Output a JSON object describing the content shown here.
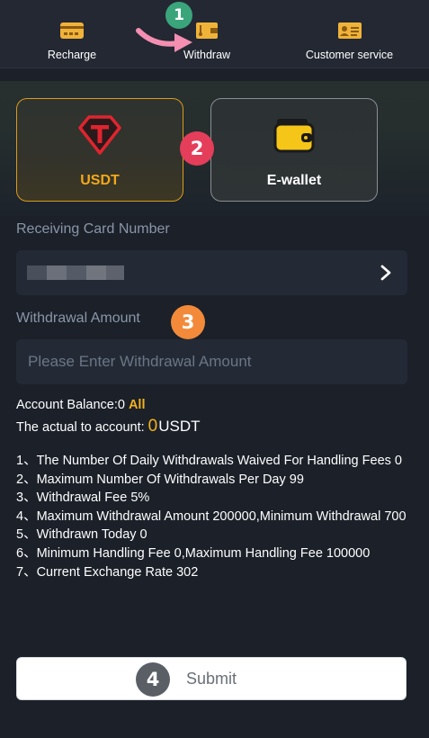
{
  "nav": {
    "items": [
      {
        "label": "Recharge",
        "icon": "recharge-card-icon"
      },
      {
        "label": "Withdraw",
        "icon": "withdraw-wallet-icon"
      },
      {
        "label": "Customer service",
        "icon": "customer-service-id-card-icon"
      }
    ]
  },
  "annotations": {
    "step1": "1",
    "step2": "2",
    "step3": "3",
    "step4": "4"
  },
  "methods": [
    {
      "label": "USDT",
      "icon": "tether-usdt-icon",
      "selected": true
    },
    {
      "label": "E-wallet",
      "icon": "wallet-icon",
      "selected": false
    }
  ],
  "form": {
    "card_number_label": "Receiving Card Number",
    "amount_label": "Withdrawal Amount",
    "amount_placeholder": "Please Enter Withdrawal Amount"
  },
  "balance": {
    "label": "Account Balance:",
    "value": "0",
    "all_label": "All",
    "actual_label": "The actual to account:",
    "actual_value": "0",
    "actual_unit": "USDT"
  },
  "rules": [
    "1、The Number Of Daily Withdrawals Waived For Handling Fees 0",
    "2、Maximum Number Of Withdrawals Per Day 99",
    "3、Withdrawal Fee 5%",
    "4、Maximum Withdrawal Amount 200000,Minimum Withdrawal 700",
    "5、Withdrawn Today 0",
    "6、Minimum Handling Fee 0,Maximum Handling Fee 100000",
    "7、Current Exchange Rate 302"
  ],
  "submit_label": "Submit",
  "colors": {
    "accent": "#f3b21c",
    "background": "#1b2029",
    "badge_green": "#3aa57a",
    "badge_red": "#e43e5a",
    "badge_orange": "#f28a3a",
    "badge_gray": "#5a5f66"
  }
}
